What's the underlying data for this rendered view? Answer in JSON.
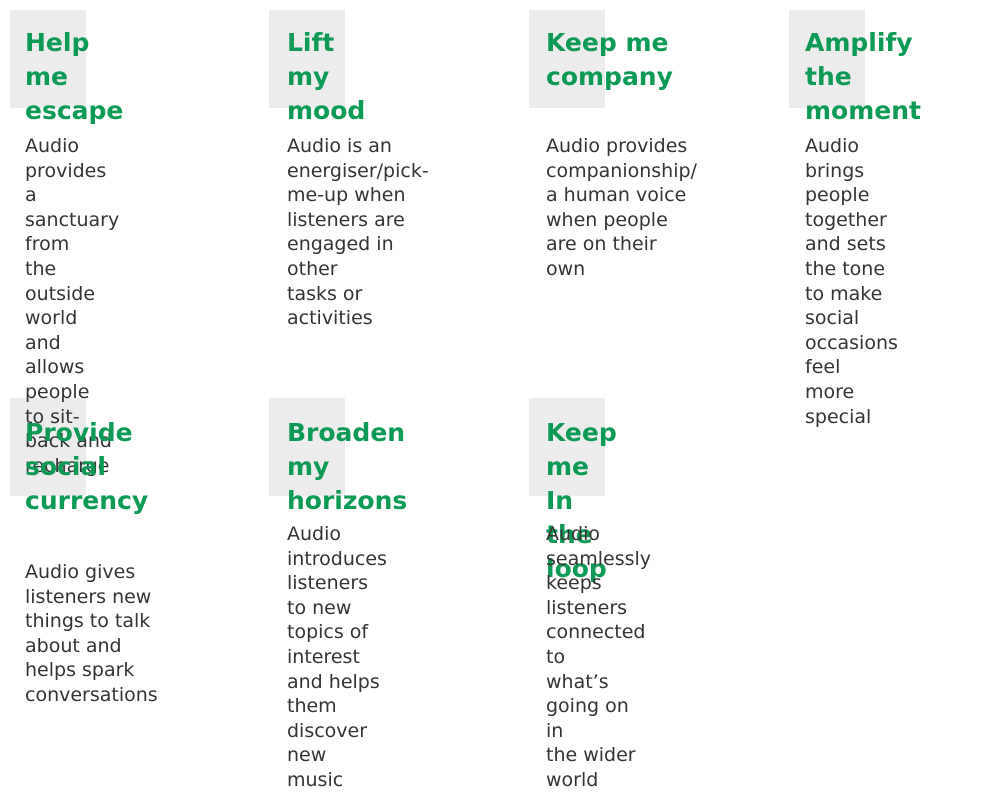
{
  "cards": [
    {
      "title": "Help me\nescape",
      "description": "Audio provides a\nsanctuary from\nthe outside world\nand allows people\nto sit-back and\nrecharge"
    },
    {
      "title": "Lift my\nmood",
      "description": "Audio is an\nenergiser/pick-\nme-up when\nlisteners are\nengaged in other\ntasks or activities"
    },
    {
      "title": "Keep me\ncompany",
      "description": "Audio provides\ncompanionship/\na human voice\nwhen people\nare on their\nown"
    },
    {
      "title": "Amplify the\nmoment",
      "description": "Audio brings\npeople together\nand sets the tone\nto make social\noccasions feel\nmore special"
    },
    {
      "title": "Provide\nsocial\ncurrency",
      "description": "Audio gives\nlisteners new\nthings to talk\nabout and\nhelps spark\nconversations"
    },
    {
      "title": "Broaden my\nhorizons",
      "description": "Audio introduces\nlisteners to new\ntopics of interest\nand helps them\ndiscover new\nmusic"
    },
    {
      "title": "Keep me In\nthe loop",
      "description": "Audio seamlessly\nkeeps listeners\nconnected to\nwhat’s going on in\nthe wider world"
    }
  ],
  "colors": {
    "title_green": "#0d9a55",
    "accent_gray": "#ececec",
    "body_text": "#333333"
  }
}
